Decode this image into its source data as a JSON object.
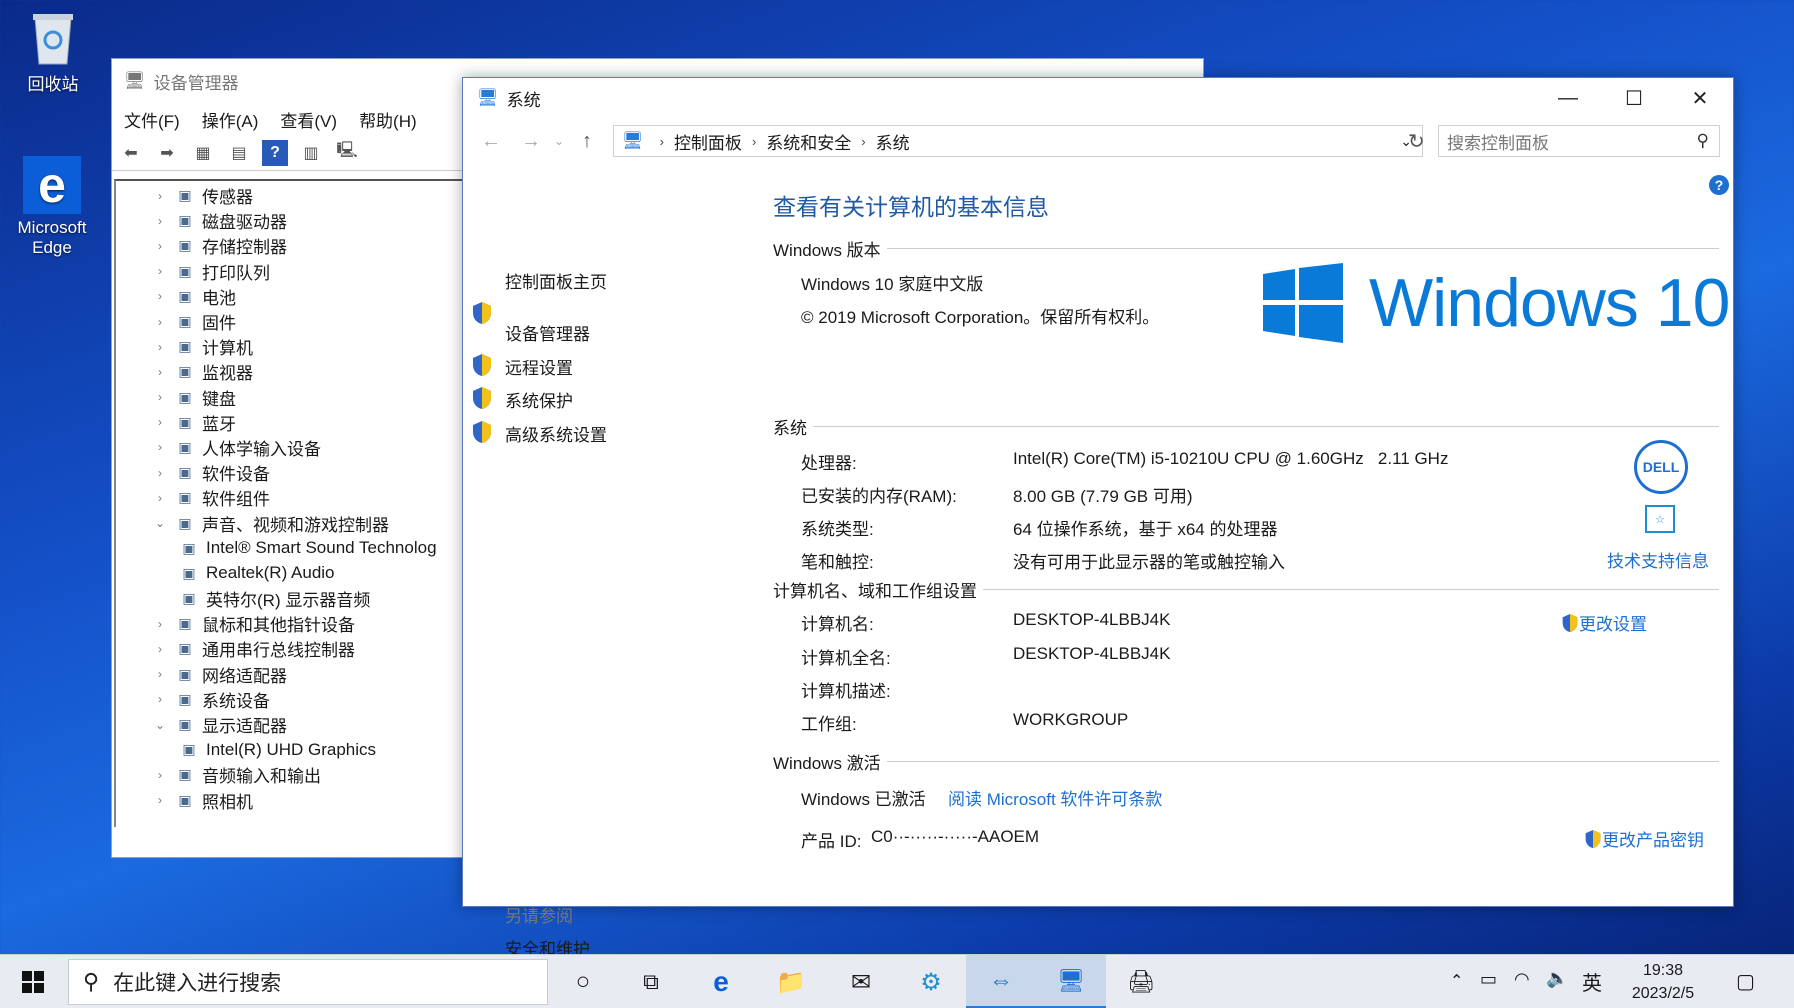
{
  "desktop": {
    "recycle_bin": "回收站",
    "edge_line1": "Microsoft",
    "edge_line2": "Edge"
  },
  "device_manager": {
    "title": "设备管理器",
    "menu": [
      "文件(F)",
      "操作(A)",
      "查看(V)",
      "帮助(H)"
    ],
    "tree": [
      {
        "label": "传感器",
        "expanded": false,
        "child": false
      },
      {
        "label": "磁盘驱动器",
        "expanded": false,
        "child": false
      },
      {
        "label": "存储控制器",
        "expanded": false,
        "child": false
      },
      {
        "label": "打印队列",
        "expanded": false,
        "child": false
      },
      {
        "label": "电池",
        "expanded": false,
        "child": false
      },
      {
        "label": "固件",
        "expanded": false,
        "child": false
      },
      {
        "label": "计算机",
        "expanded": false,
        "child": false
      },
      {
        "label": "监视器",
        "expanded": false,
        "child": false
      },
      {
        "label": "键盘",
        "expanded": false,
        "child": false
      },
      {
        "label": "蓝牙",
        "expanded": false,
        "child": false
      },
      {
        "label": "人体学输入设备",
        "expanded": false,
        "child": false
      },
      {
        "label": "软件设备",
        "expanded": false,
        "child": false
      },
      {
        "label": "软件组件",
        "expanded": false,
        "child": false
      },
      {
        "label": "声音、视频和游戏控制器",
        "expanded": true,
        "child": false
      },
      {
        "label": "Intel® Smart Sound Technolog",
        "expanded": false,
        "child": true
      },
      {
        "label": "Realtek(R) Audio",
        "expanded": false,
        "child": true
      },
      {
        "label": "英特尔(R) 显示器音频",
        "expanded": false,
        "child": true
      },
      {
        "label": "鼠标和其他指针设备",
        "expanded": false,
        "child": false
      },
      {
        "label": "通用串行总线控制器",
        "expanded": false,
        "child": false
      },
      {
        "label": "网络适配器",
        "expanded": false,
        "child": false
      },
      {
        "label": "系统设备",
        "expanded": false,
        "child": false
      },
      {
        "label": "显示适配器",
        "expanded": true,
        "child": false
      },
      {
        "label": "Intel(R) UHD Graphics",
        "expanded": false,
        "child": true
      },
      {
        "label": "音频输入和输出",
        "expanded": false,
        "child": false
      },
      {
        "label": "照相机",
        "expanded": false,
        "child": false
      }
    ]
  },
  "system_window": {
    "title": "系统",
    "breadcrumb": [
      "控制面板",
      "系统和安全",
      "系统"
    ],
    "search_placeholder": "搜索控制面板",
    "left_pane": {
      "home": "控制面板主页",
      "links": [
        "设备管理器",
        "远程设置",
        "系统保护",
        "高级系统设置"
      ],
      "see_also_title": "另请参阅",
      "see_also": "安全和维护"
    },
    "heading": "查看有关计算机的基本信息",
    "edition": {
      "section": "Windows 版本",
      "name": "Windows 10 家庭中文版",
      "copyright": "© 2019 Microsoft Corporation。保留所有权利。",
      "logo_text": "Windows 10"
    },
    "system": {
      "section": "系统",
      "rows": [
        {
          "label": "处理器:",
          "value": "Intel(R) Core(TM) i5-10210U CPU @ 1.60GHz   2.11 GHz"
        },
        {
          "label": "已安装的内存(RAM):",
          "value": "8.00 GB (7.79 GB 可用)"
        },
        {
          "label": "系统类型:",
          "value": "64 位操作系统，基于 x64 的处理器"
        },
        {
          "label": "笔和触控:",
          "value": "没有可用于此显示器的笔或触控输入"
        }
      ],
      "oem_logo": "DELL",
      "support_link": "技术支持信息"
    },
    "computer": {
      "section": "计算机名、域和工作组设置",
      "rows": [
        {
          "label": "计算机名:",
          "value": "DESKTOP-4LBBJ4K"
        },
        {
          "label": "计算机全名:",
          "value": "DESKTOP-4LBBJ4K"
        },
        {
          "label": "计算机描述:",
          "value": ""
        },
        {
          "label": "工作组:",
          "value": "WORKGROUP"
        }
      ],
      "change_link": "更改设置"
    },
    "activation": {
      "section": "Windows 激活",
      "status": "Windows 已激活",
      "license_link": "阅读 Microsoft 软件许可条款",
      "product_id_label": "产品 ID:",
      "product_id_value": "C0··-·····-·····-AAOEM",
      "change_key_link": "更改产品密钥"
    }
  },
  "taskbar": {
    "search_placeholder": "在此键入进行搜索",
    "ime": "英",
    "time": "19:38",
    "date": "2023/2/5"
  }
}
